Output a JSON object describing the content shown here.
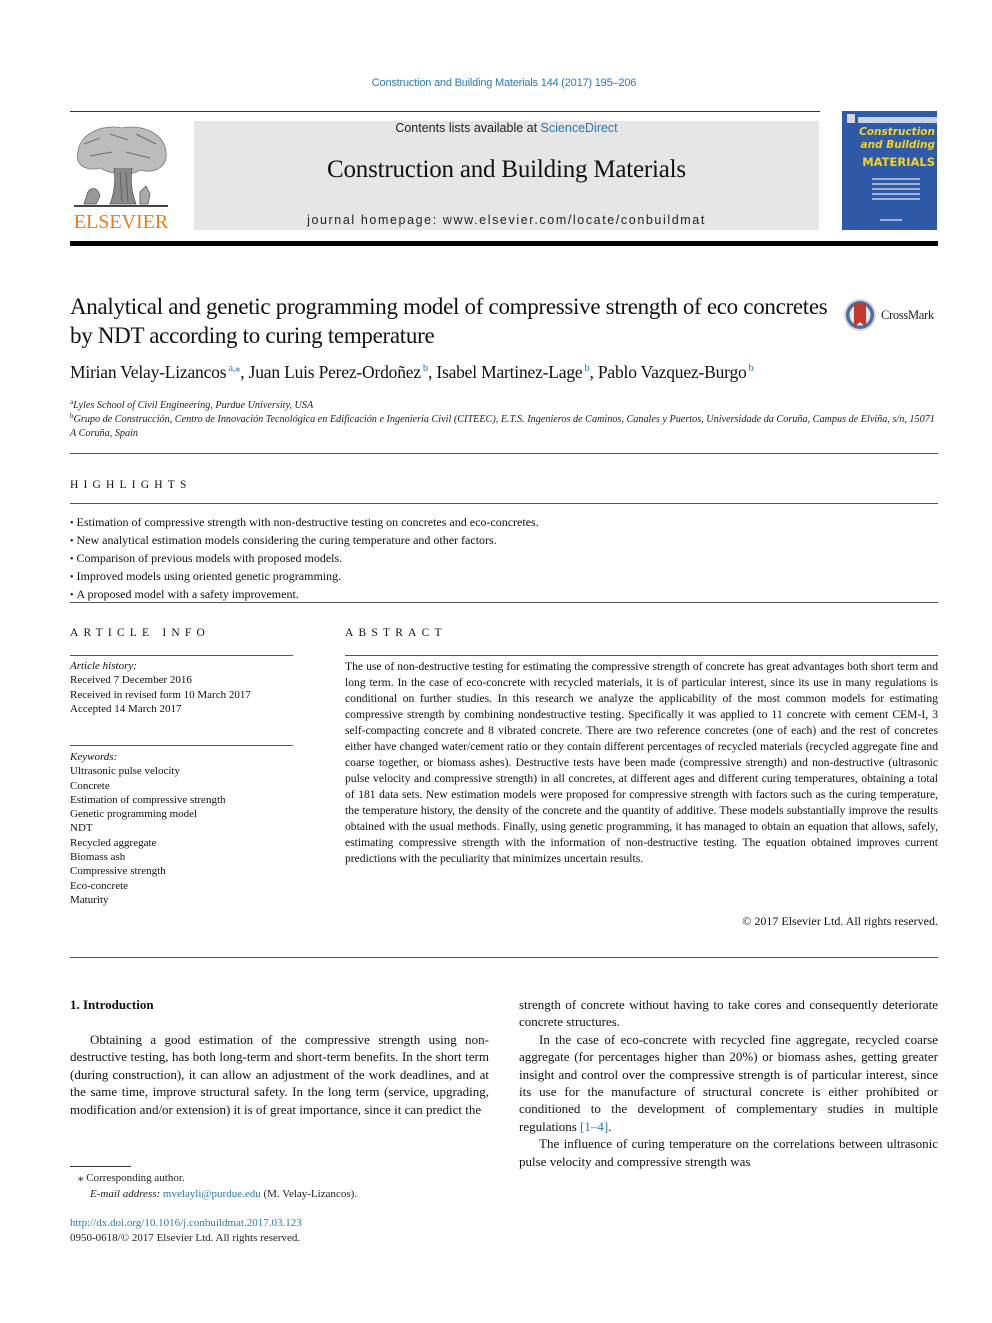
{
  "header": {
    "journal_reference": "Construction and Building Materials 144 (2017) 195–206",
    "contents_prefix": "Contents lists available at ",
    "contents_link": "ScienceDirect",
    "journal_title": "Construction and Building Materials",
    "homepage_prefix": "journal homepage: ",
    "homepage_url": "www.elsevier.com/locate/conbuildmat",
    "publisher_logo_text": "ELSEVIER",
    "cover": {
      "title_line1": "Construction",
      "title_line2": "and Building",
      "title_line3": "MATERIALS"
    },
    "colors": {
      "link": "#2a7ab0",
      "elsevier_orange": "#f07a1a",
      "cover_blue": "#2e5aa8",
      "cover_yellow": "#f5d324",
      "banner_gray": "#e6e6e6"
    }
  },
  "article": {
    "title": "Analytical and genetic programming model of compressive strength of eco concretes by NDT according to curing temperature",
    "crossmark_label": "CrossMark",
    "authors": [
      {
        "name": "Mirian Velay-Lizancos",
        "sup": "a,⁎",
        "sep": ", "
      },
      {
        "name": "Juan Luis Perez-Ordoñez",
        "sup": "b",
        "sep": ", "
      },
      {
        "name": "Isabel Martinez-Lage",
        "sup": "b",
        "sep": ", "
      },
      {
        "name": "Pablo Vazquez-Burgo",
        "sup": "b",
        "sep": ""
      }
    ],
    "affiliations": [
      {
        "mark": "a",
        "text": "Lyles School of Civil Engineering, Purdue University, USA"
      },
      {
        "mark": "b",
        "text": "Grupo de Construcción, Centro de Innovación Tecnológica en Edificación e Ingeniería Civil (CITEEC), E.T.S. Ingenieros de Caminos, Canales y Puertos, Universidade da Coruña, Campus de Elviña, s/n, 15071 A Coruña, Spain"
      }
    ]
  },
  "highlights": {
    "heading": "HIGHLIGHTS",
    "items": [
      "Estimation of compressive strength with non-destructive testing on concretes and eco-concretes.",
      "New analytical estimation models considering the curing temperature and other factors.",
      "Comparison of previous models with proposed models.",
      "Improved models using oriented genetic programming.",
      "A proposed model with a safety improvement."
    ]
  },
  "article_info": {
    "heading": "ARTICLE INFO",
    "history_label": "Article history:",
    "history": [
      "Received 7 December 2016",
      "Received in revised form 10 March 2017",
      "Accepted 14 March 2017"
    ],
    "keywords_label": "Keywords:",
    "keywords": [
      "Ultrasonic pulse velocity",
      "Concrete",
      "Estimation of compressive strength",
      "Genetic programming model",
      "NDT",
      "Recycled aggregate",
      "Biomass ash",
      "Compressive strength",
      "Eco-concrete",
      "Maturity"
    ]
  },
  "abstract": {
    "heading": "ABSTRACT",
    "text": "The use of non-destructive testing for estimating the compressive strength of concrete has great advantages both short term and long term. In the case of eco-concrete with recycled materials, it is of particular interest, since its use in many regulations is conditional on further studies. In this research we analyze the applicability of the most common models for estimating compressive strength by combining nondestructive testing. Specifically it was applied to 11 concrete with cement CEM-I, 3 self-compacting concrete and 8 vibrated concrete. There are two reference concretes (one of each) and the rest of concretes either have changed water/cement ratio or they contain different percentages of recycled materials (recycled aggregate fine and coarse together, or biomass ashes). Destructive tests have been made (compressive strength) and non-destructive (ultrasonic pulse velocity and compressive strength) in all concretes, at different ages and different curing temperatures, obtaining a total of 181 data sets. New estimation models were proposed for compressive strength with factors such as the curing temperature, the temperature history, the density of the concrete and the quantity of additive. These models substantially improve the results obtained with the usual methods. Finally, using genetic programming, it has managed to obtain an equation that allows, safely, estimating compressive strength with the information of non-destructive testing. The equation obtained improves current predictions with the peculiarity that minimizes uncertain results.",
    "copyright": "© 2017 Elsevier Ltd. All rights reserved."
  },
  "body": {
    "section_heading": "1. Introduction",
    "left_paragraph": "Obtaining a good estimation of the compressive strength using non-destructive testing, has both long-term and short-term benefits. In the short term (during construction), it can allow an adjustment of the work deadlines, and at the same time, improve structural safety. In the long term (service, upgrading, modification and/or extension) it is of great importance, since it can predict the",
    "right_paragraph_1": "strength of concrete without having to take cores and consequently deteriorate concrete structures.",
    "right_paragraph_2": "In the case of eco-concrete with recycled fine aggregate, recycled coarse aggregate (for percentages higher than 20%) or biomass ashes, getting greater insight and control over the compressive strength is of particular interest, since its use for the manufacture of structural concrete is either prohibited or conditioned to the development of complementary studies in multiple regulations ",
    "right_paragraph_2_ref": "[1–4]",
    "right_paragraph_2_end": ".",
    "right_paragraph_3": "The influence of curing temperature on the correlations between ultrasonic pulse velocity and compressive strength was"
  },
  "footnotes": {
    "corresponding_mark": "⁎",
    "corresponding_label": "Corresponding author.",
    "email_label": "E-mail address: ",
    "email": "mvelayli@purdue.edu",
    "email_owner": " (M. Velay-Lizancos).",
    "doi": "http://dx.doi.org/10.1016/j.conbuildmat.2017.03.123",
    "issn_line": "0950-0618/© 2017 Elsevier Ltd. All rights reserved."
  }
}
